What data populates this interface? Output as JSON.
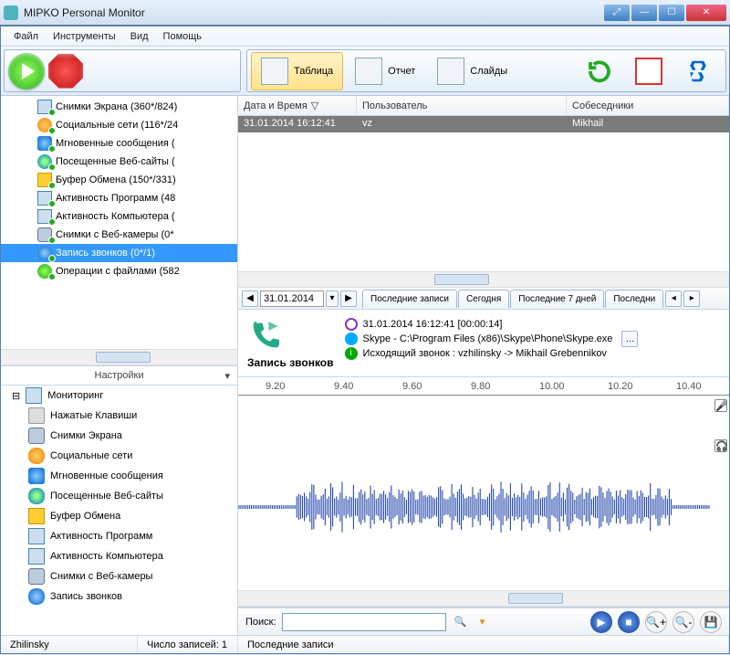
{
  "window": {
    "title": "MIPKO Personal Monitor"
  },
  "menu": {
    "file": "Файл",
    "tools": "Инструменты",
    "view": "Вид",
    "help": "Помощь"
  },
  "toolbar": {
    "table": "Таблица",
    "report": "Отчет",
    "slides": "Слайды"
  },
  "tree": {
    "items": [
      {
        "label": "Снимки Экрана (360*/824)",
        "icon": "ic-mon"
      },
      {
        "label": "Социальные сети (116*/24",
        "icon": "ic-orange"
      },
      {
        "label": "Мгновенные сообщения (",
        "icon": "ic-blue"
      },
      {
        "label": "Посещенные Веб-сайты (",
        "icon": "ic-globe"
      },
      {
        "label": "Буфер Обмена (150*/331)",
        "icon": "ic-yellow"
      },
      {
        "label": "Активность Программ (48",
        "icon": "ic-mon"
      },
      {
        "label": "Активность Компьютера (",
        "icon": "ic-mon"
      },
      {
        "label": "Снимки с Веб-камеры (0*",
        "icon": "ic-cam"
      },
      {
        "label": "Запись звонков (0*/1)",
        "icon": "ic-phone",
        "selected": true
      },
      {
        "label": "Операции с файлами (582",
        "icon": "ic-green"
      }
    ]
  },
  "settingsHeader": "Настройки",
  "settings": {
    "root": "Мониторинг",
    "items": [
      {
        "label": "Нажатые Клавиши",
        "icon": "ic-key"
      },
      {
        "label": "Снимки Экрана",
        "icon": "ic-cam"
      },
      {
        "label": "Социальные сети",
        "icon": "ic-orange"
      },
      {
        "label": "Мгновенные сообщения",
        "icon": "ic-blue"
      },
      {
        "label": "Посещенные Веб-сайты",
        "icon": "ic-globe"
      },
      {
        "label": "Буфер Обмена",
        "icon": "ic-yellow"
      },
      {
        "label": "Активность Программ",
        "icon": "ic-mon"
      },
      {
        "label": "Активность Компьютера",
        "icon": "ic-mon"
      },
      {
        "label": "Снимки с Веб-камеры",
        "icon": "ic-cam"
      },
      {
        "label": "Запись звонков",
        "icon": "ic-phone"
      }
    ]
  },
  "grid": {
    "cols": {
      "datetime": "Дата и Время",
      "user": "Пользователь",
      "peers": "Собеседники"
    },
    "rows": [
      {
        "datetime": "31.01.2014 16:12:41",
        "user": "vz",
        "peers": "Mikhail"
      }
    ]
  },
  "dateNav": {
    "date": "31.01.2014",
    "tabs": [
      "Последние записи",
      "Сегодня",
      "Последние 7 дней",
      "Последни"
    ]
  },
  "detail": {
    "title": "Запись звонков",
    "time": "31.01.2014 16:12:41 [00:00:14]",
    "app": "Skype - C:\\Program Files (x86)\\Skype\\Phone\\Skype.exe",
    "call": "Исходящий звонок : vzhilinsky -> Mikhail Grebennikov"
  },
  "ruler": [
    "9.20",
    "9.40",
    "9.60",
    "9.80",
    "10.00",
    "10.20",
    "10.40"
  ],
  "search": {
    "label": "Поиск:",
    "value": ""
  },
  "status": {
    "user": "Zhilinsky",
    "countLabel": "Число записей:",
    "count": "1",
    "section": "Последние записи"
  }
}
